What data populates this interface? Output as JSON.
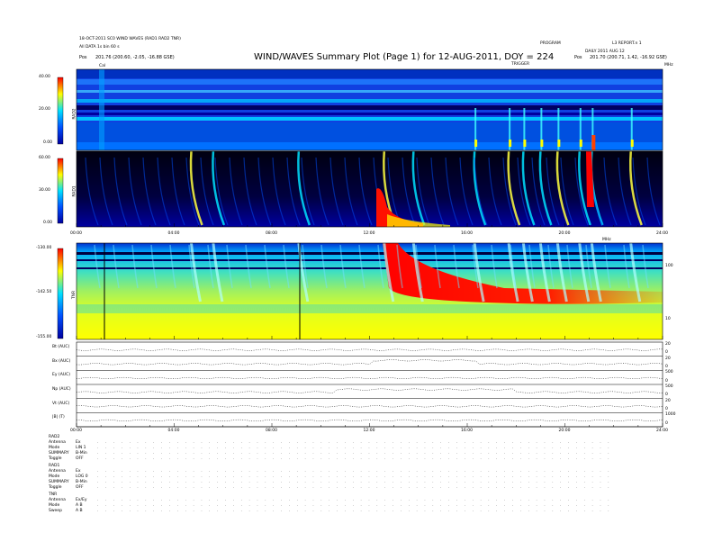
{
  "header": {
    "left_line1": "18-OCT-2011 SC0 WIND WAVES (RAD1 RAD2 TNR)",
    "left_line2": "All DATA 1s bin 60 s",
    "left_line3_label": "Pos",
    "left_line3_value": "201.76 (200.60, -2.05, -16.88 GSE)",
    "title": "WIND/WAVES Summary Plot (Page 1) for 12-AUG-2011, DOY = 224",
    "right_line1a": "PROGRAM",
    "right_line1b": "L3 REPORT.n 1",
    "right_line2": "DAILY 2011 AUG 12",
    "right_line3_label": "Pos",
    "right_line3_value": "201.70 (200.71, 1.42, -16.92 GSE)",
    "mid_label": "TRIGGER",
    "cal_marker": "Cal",
    "freq_marker": "MHz"
  },
  "panels": {
    "rad2": {
      "label": "RAD2",
      "ticks": [
        "40.00",
        "20.00",
        "0.00"
      ]
    },
    "rad1": {
      "label": "RAD1",
      "ticks": [
        "60.00",
        "30.00",
        "0.00"
      ]
    },
    "tnr": {
      "label": "TNR",
      "ticks": [
        "-130.00",
        "-142.50",
        "-155.00"
      ],
      "right_ticks": [
        "100",
        "10"
      ],
      "right_label": "MHz"
    }
  },
  "time_axis": {
    "ticks": [
      "00:00",
      "04:00",
      "08:00",
      "12:00",
      "16:00",
      "20:00",
      "24:00"
    ]
  },
  "line_panels": [
    {
      "label": "Bt (AUC)",
      "right": [
        "20",
        "0"
      ]
    },
    {
      "label": "Bx (AUC)",
      "right": [
        "20",
        "0"
      ]
    },
    {
      "label": "Ey (AUC)",
      "right": [
        "500",
        "0"
      ]
    },
    {
      "label": "Np (AUC)",
      "right": [
        "500",
        "0"
      ]
    },
    {
      "label": "Vt (AUC)",
      "right": [
        "20",
        "0"
      ]
    },
    {
      "label": "|B| (T)",
      "right": [
        "1000",
        "0"
      ]
    }
  ],
  "footer": {
    "groups": [
      {
        "title": "RAD2",
        "rows": [
          [
            "Antenna",
            "Ex"
          ],
          [
            "Mode",
            "LIN 1"
          ],
          [
            "SUMMARY",
            "B-Min"
          ],
          [
            "Toggle",
            "OFF"
          ]
        ]
      },
      {
        "title": "RAD1",
        "rows": [
          [
            "Antenna",
            "Ex"
          ],
          [
            "Mode",
            "LOG 0"
          ],
          [
            "SUMMARY",
            "B-Min"
          ],
          [
            "Toggle",
            "OFF"
          ]
        ]
      },
      {
        "title": "TNR",
        "rows": [
          [
            "Antenna",
            "Ex/Ey"
          ],
          [
            "Mode",
            "A B"
          ],
          [
            "Sweep",
            "A B"
          ]
        ]
      }
    ]
  },
  "chart_data": {
    "type": "heatmap",
    "title": "WIND/WAVES Summary Plot (Page 1) for 12-AUG-2011, DOY = 224",
    "x_unit": "hours UT",
    "xlim": [
      0,
      24
    ],
    "xticks": [
      "00:00",
      "04:00",
      "08:00",
      "12:00",
      "16:00",
      "20:00",
      "24:00"
    ],
    "panels": [
      {
        "name": "RAD2",
        "ylim": [
          0,
          40
        ],
        "colorscale": [
          "#0000a0",
          "#0050ff",
          "#00e0ff",
          "#ffff00",
          "#ff0000"
        ]
      },
      {
        "name": "RAD1",
        "ylim": [
          0,
          60
        ],
        "colorscale": [
          "#000020",
          "#0000a0",
          "#00c0ff",
          "#ffff00",
          "#ff0000"
        ]
      },
      {
        "name": "TNR",
        "ylim": [
          -155,
          -130
        ],
        "colorscale": [
          "#ffff00",
          "#80ff80",
          "#00e0ff",
          "#0040ff",
          "#ff0000"
        ]
      }
    ],
    "radio_bursts_hours": [
      4.7,
      5.6,
      9.1,
      12.6,
      13.8,
      16.3,
      17.7,
      18.3,
      19.0,
      19.7,
      20.6,
      21.1,
      22.7
    ],
    "strong_burst": {
      "start_hour": 12.5,
      "peak_hour": 12.7,
      "end_hour": 17.0
    },
    "cal_hour": 1.1,
    "data_gap_hour": 9.3
  }
}
